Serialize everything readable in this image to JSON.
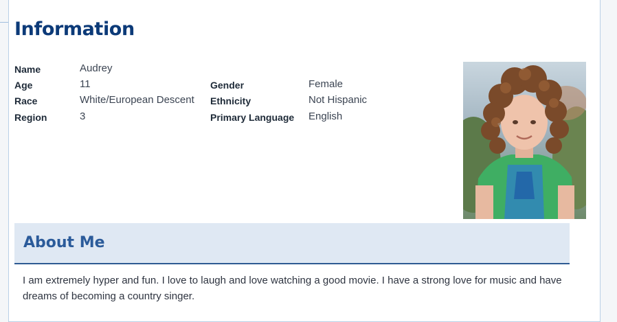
{
  "profile": {
    "section_title": "Information",
    "fields": {
      "name_label": "Name",
      "name_value": "Audrey",
      "age_label": "Age",
      "age_value": "11",
      "gender_label": "Gender",
      "gender_value": "Female",
      "race_label": "Race",
      "race_value": "White/European Descent",
      "ethnicity_label": "Ethnicity",
      "ethnicity_value": "Not Hispanic",
      "region_label": "Region",
      "region_value": "3",
      "language_label": "Primary Language",
      "language_value": "English"
    },
    "photo_alt": "profile-photo"
  },
  "about": {
    "title": "About Me",
    "text": "I am extremely hyper and fun. I love to laugh and love watching a good movie. I have a strong love for music and have dreams of becoming a country singer."
  },
  "colors": {
    "title": "#0c3a78",
    "about_title": "#2b5b9a",
    "about_bg": "#dfe8f3",
    "about_rule": "#2d5a92"
  }
}
